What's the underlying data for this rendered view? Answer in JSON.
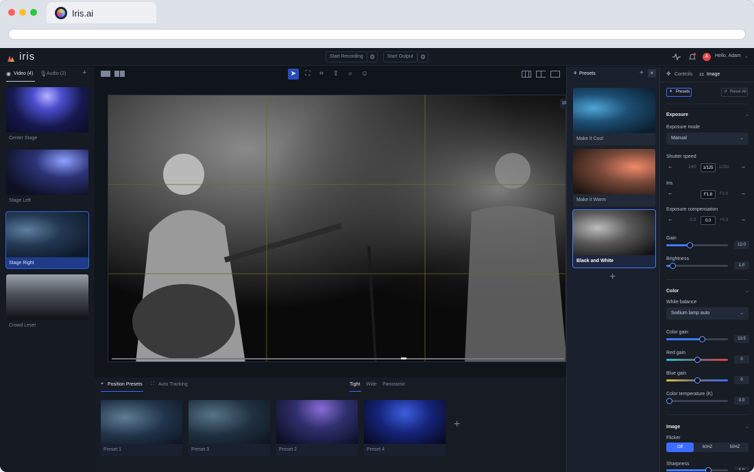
{
  "browser": {
    "tab_title": "Iris.ai"
  },
  "app": {
    "logo_text": "iris",
    "start_recording": "Start Recording",
    "start_output": "Start Output",
    "greeting": "Hello, Adam",
    "avatar_initial": "A"
  },
  "sources": {
    "tabs": [
      {
        "label": "Video (4)"
      },
      {
        "label": "Audio (2)"
      }
    ],
    "items": [
      {
        "label": "Center Stage"
      },
      {
        "label": "Stage Left"
      },
      {
        "label": "Stage Right"
      },
      {
        "label": "Crowd Level"
      }
    ]
  },
  "stage": {
    "badge": "10"
  },
  "position_presets": {
    "tabs": [
      {
        "label": "Position Presets"
      },
      {
        "label": "Auto Tracking"
      }
    ],
    "shots": [
      {
        "label": "Tight"
      },
      {
        "label": "Wide"
      },
      {
        "label": "Panoramic"
      }
    ],
    "items": [
      {
        "label": "Preset 1"
      },
      {
        "label": "Preset 3"
      },
      {
        "label": "Preset 2"
      },
      {
        "label": "Preset 4"
      }
    ]
  },
  "presets_panel": {
    "title": "Presets",
    "items": [
      {
        "label": "Make it Cool"
      },
      {
        "label": "Make it Warm"
      },
      {
        "label": "Black and White"
      }
    ]
  },
  "right_panel": {
    "tabs": [
      {
        "label": "Controls"
      },
      {
        "label": "Image"
      }
    ],
    "presets_button": "Presets",
    "reset_button": "Reset All",
    "exposure": {
      "title": "Exposure",
      "mode_label": "Exposure mode",
      "mode_value": "Manual",
      "shutter_label": "Shutter speed",
      "shutter_values": [
        "1/60",
        "1/125",
        "1/250"
      ],
      "iris_label": "Iris",
      "iris_values": [
        "F1.8",
        "F2.0"
      ],
      "comp_label": "Exposure compensation",
      "comp_values": [
        "-0.3",
        "0.0",
        "+0.3"
      ],
      "gain_label": "Gain",
      "gain_value": "12.0",
      "gain_level": 0.38,
      "brightness_label": "Brightness",
      "brightness_value": "1.0",
      "brightness_level": 0.1
    },
    "color": {
      "title": "Color",
      "wb_label": "White balance",
      "wb_value": "Sodium lamp auto",
      "color_gain_label": "Color gain",
      "color_gain_value": "13.5",
      "color_gain_level": 0.58,
      "red_gain_label": "Red gain",
      "red_gain_value": "0",
      "red_gain_level": 0.5,
      "blue_gain_label": "Blue gain",
      "blue_gain_value": "0",
      "blue_gain_level": 0.5,
      "temp_label": "Color temperature (K)",
      "temp_value": "0.0",
      "temp_level": 0.05
    },
    "image": {
      "title": "Image",
      "flicker_label": "Flicker",
      "flicker_options": [
        {
          "label": "Off"
        },
        {
          "label": "60HZ"
        },
        {
          "label": "50HZ"
        }
      ],
      "sharpness_label": "Sharpness",
      "sharpness_value": "5.0",
      "sharpness_level": 0.68
    }
  },
  "colors": {
    "accent": "#3d6dff",
    "bg": "#10141b",
    "panel": "#171c25",
    "selected": "#1f3b8a"
  }
}
